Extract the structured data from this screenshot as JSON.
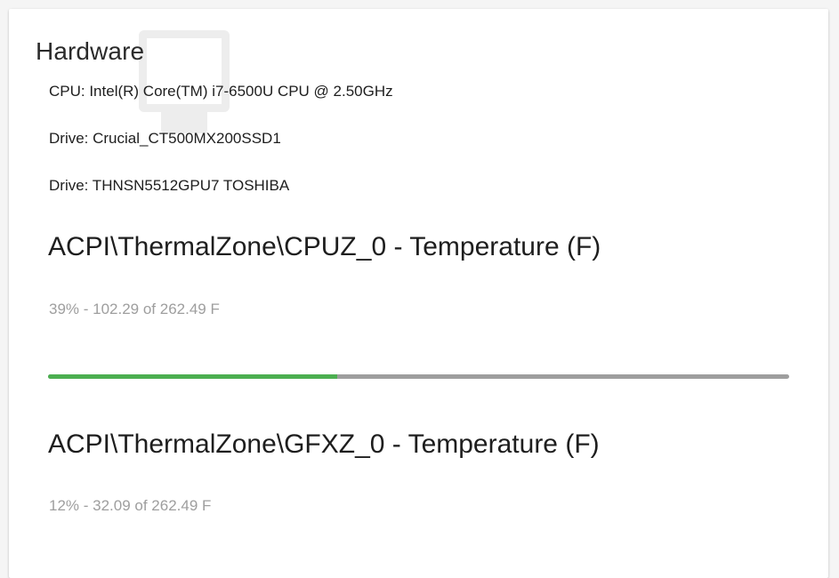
{
  "card": {
    "title": "Hardware",
    "background_icon": "monitor-icon"
  },
  "info": [
    "CPU: Intel(R) Core(TM) i7-6500U CPU @ 2.50GHz",
    "Drive: Crucial_CT500MX200SSD1",
    "Drive: THNSN5512GPU7 TOSHIBA"
  ],
  "sensors": [
    {
      "title": "ACPI\\ThermalZone\\CPUZ_0 - Temperature (F)",
      "summary": "39% - 102.29 of 262.49 F",
      "percent": 39
    },
    {
      "title": "ACPI\\ThermalZone\\GFXZ_0 - Temperature (F)",
      "summary": "12% - 32.09 of 262.49 F",
      "percent": 12
    }
  ],
  "colors": {
    "progress_fill": "#4caf50",
    "progress_track": "#9e9e9e",
    "muted_text": "#9e9e9e"
  }
}
